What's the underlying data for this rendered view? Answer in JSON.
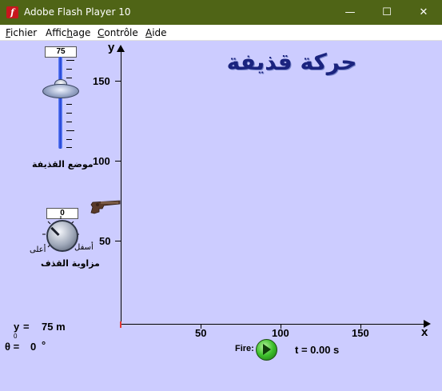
{
  "window": {
    "title": "Adobe Flash Player 10",
    "icon": "flash-player-icon",
    "controls": {
      "minimize": "—",
      "maximize": "☐",
      "close": "✕"
    }
  },
  "menu": {
    "items": [
      {
        "label_pre": "",
        "label_ul": "F",
        "label_post": "ichier"
      },
      {
        "label_pre": "Affic",
        "label_ul": "h",
        "label_post": "age"
      },
      {
        "label_pre": "",
        "label_ul": "C",
        "label_post": "ontrôle"
      },
      {
        "label_pre": "",
        "label_ul": "A",
        "label_post": "ide"
      }
    ]
  },
  "stage": {
    "background": "#ccccff",
    "heading": "حركة قذيفة",
    "heading_color": "#1a237e",
    "axis": {
      "y_label": "y",
      "x_label": "x",
      "y_ticks": [
        "150",
        "100",
        "50"
      ],
      "x_ticks": [
        "50",
        "100",
        "150"
      ]
    },
    "height_slider": {
      "value": "75",
      "value_fraction": 0.5,
      "label": "موضع القذيفة"
    },
    "angle_knob": {
      "value": "0",
      "label": "مزاوية القذف",
      "low_label": "أسفل",
      "high_label": "أعلى"
    },
    "readouts": {
      "y0_label": "y",
      "y0_sub": "0",
      "y0_eq": "=",
      "y0_value": "75 m",
      "theta_label": "θ =",
      "theta_value": "0",
      "theta_unit": "°",
      "time": "t = 0.00 s"
    },
    "fire": {
      "label": "Fire:"
    }
  }
}
